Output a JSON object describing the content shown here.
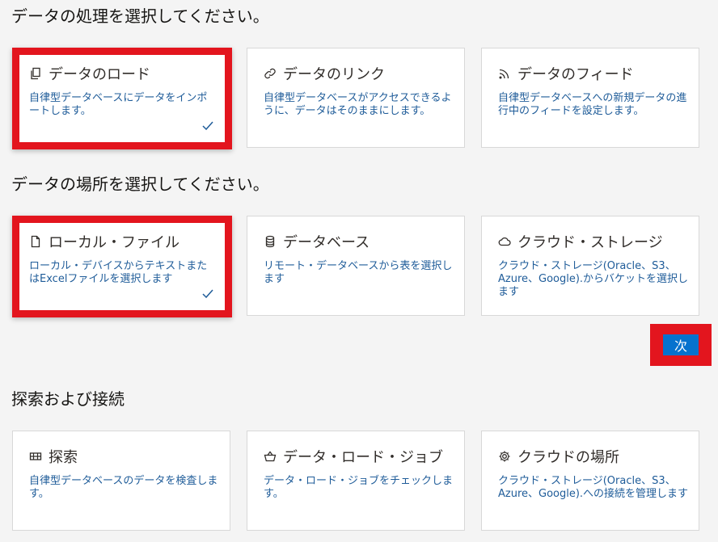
{
  "sections": {
    "processing": {
      "heading": "データの処理を選択してください。"
    },
    "location": {
      "heading": "データの場所を選択してください。"
    },
    "explore": {
      "heading": "探索および接続"
    }
  },
  "processing_cards": [
    {
      "title": "データのロード",
      "desc": "自律型データベースにデータをインポートします。",
      "icon": "copy-icon",
      "selected": true
    },
    {
      "title": "データのリンク",
      "desc": "自律型データベースがアクセスできるように、データはそのままにします。",
      "icon": "link-icon",
      "selected": false
    },
    {
      "title": "データのフィード",
      "desc": "自律型データベースへの新規データの進行中のフィードを設定します。",
      "icon": "feed-icon",
      "selected": false
    }
  ],
  "location_cards": [
    {
      "title": "ローカル・ファイル",
      "desc": "ローカル・デバイスからテキストまたはExcelファイルを選択します",
      "icon": "file-icon",
      "selected": true
    },
    {
      "title": "データベース",
      "desc": "リモート・データベースから表を選択します",
      "icon": "database-icon",
      "selected": false
    },
    {
      "title": "クラウド・ストレージ",
      "desc": "クラウド・ストレージ(Oracle、S3、Azure、Google).からバケットを選択します",
      "icon": "cloud-icon",
      "selected": false
    }
  ],
  "next_button": {
    "label": "次"
  },
  "explore_cards": [
    {
      "title": "探索",
      "desc": "自律型データベースのデータを検査します。",
      "icon": "table-icon"
    },
    {
      "title": "データ・ロード・ジョブ",
      "desc": "データ・ロード・ジョブをチェックします。",
      "icon": "basket-icon"
    },
    {
      "title": "クラウドの場所",
      "desc": "クラウド・ストレージ(Oracle、S3、Azure、Google).への接続を管理します",
      "icon": "gear-icon"
    }
  ],
  "colors": {
    "highlight": "#e3151e",
    "link_text": "#1f5c99",
    "button": "#0572ce"
  }
}
